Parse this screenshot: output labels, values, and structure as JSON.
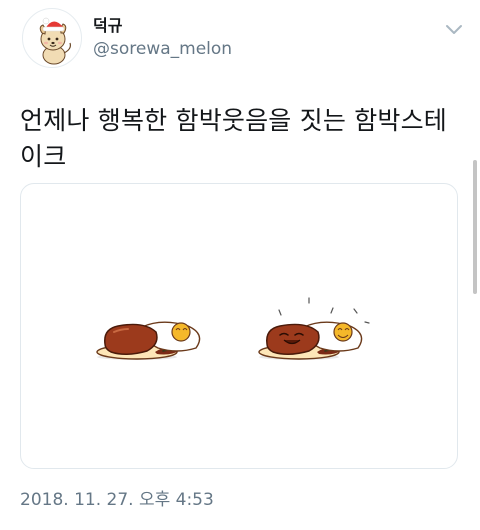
{
  "tweet": {
    "author": {
      "display_name": "덕규",
      "handle": "@sorewa_melon",
      "avatar_icon": "cartoon-dog-avatar-icon"
    },
    "text": "언제나 행복한 함박웃음을 짓는 함박스테이크",
    "media": {
      "type": "illustration",
      "icons": [
        "hamburg-steak-illustration-icon",
        "smiling-hamburg-steak-illustration-icon"
      ]
    },
    "timestamp": "2018. 11. 27. 오후 4:53"
  },
  "colors": {
    "text_primary": "#14171a",
    "text_secondary": "#657786",
    "card_border": "#e1e8ed",
    "steak_brown": "#9c3a1c",
    "yolk_yellow": "#f5b82a",
    "plate_cream": "#fde6b8"
  }
}
